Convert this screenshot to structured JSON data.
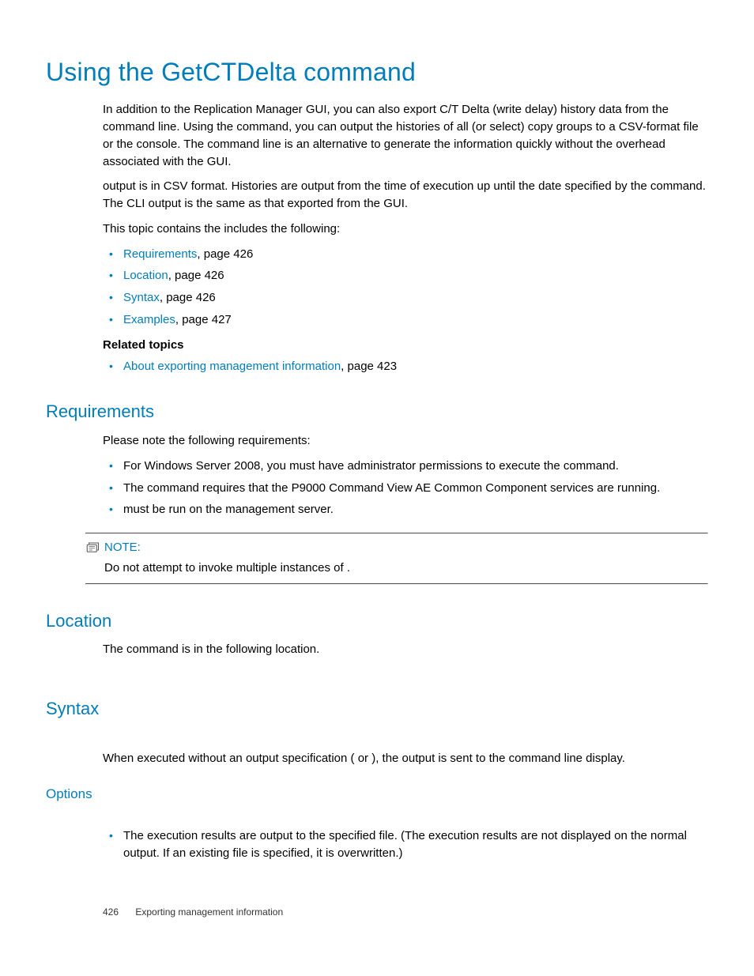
{
  "title": "Using the GetCTDelta command",
  "intro": {
    "p1a": "In addition to the Replication Manager GUI, you can also export C/T Delta (write delay) history data from the command line. Using the ",
    "p1b": " command, you can output the histories of all (or select) copy groups to a CSV-format file or the console. The command line is an alternative to generate the information quickly without the overhead associated with the GUI.",
    "p2": " output is in CSV format. Histories are output from the time of execution up until the date specified by the command. The CLI output is the same as that exported from the GUI.",
    "p3": "This topic contains the includes the following:"
  },
  "toc": [
    {
      "label": "Requirements",
      "page": ", page 426"
    },
    {
      "label": "Location",
      "page": ", page 426"
    },
    {
      "label": "Syntax",
      "page": ", page 426"
    },
    {
      "label": "Examples",
      "page": ", page 427"
    }
  ],
  "related": {
    "heading": "Related topics",
    "items": [
      {
        "label": "About exporting management information",
        "page": ", page 423"
      }
    ]
  },
  "requirements": {
    "heading": "Requirements",
    "intro": "Please note the following requirements:",
    "items": [
      "For Windows Server 2008, you must have administrator permissions to execute the command.",
      "The                    command requires that the P9000 Command View AE Common Component services are running.",
      "                       must be run on the management server."
    ]
  },
  "note": {
    "label": "NOTE:",
    "text": "Do not attempt to invoke multiple instances of                              ."
  },
  "location": {
    "heading": "Location",
    "text": "The                    command is in the following location."
  },
  "syntax": {
    "heading": "Syntax",
    "text": "When executed without an output specification (        or              ), the output is sent to the command line display."
  },
  "options": {
    "heading": "Options",
    "items": [
      "The execution results are output to the specified file. (The execution results are not displayed on the normal output. If an existing file is specified, it is overwritten.)"
    ]
  },
  "footer": {
    "page": "426",
    "section": "Exporting management information"
  }
}
